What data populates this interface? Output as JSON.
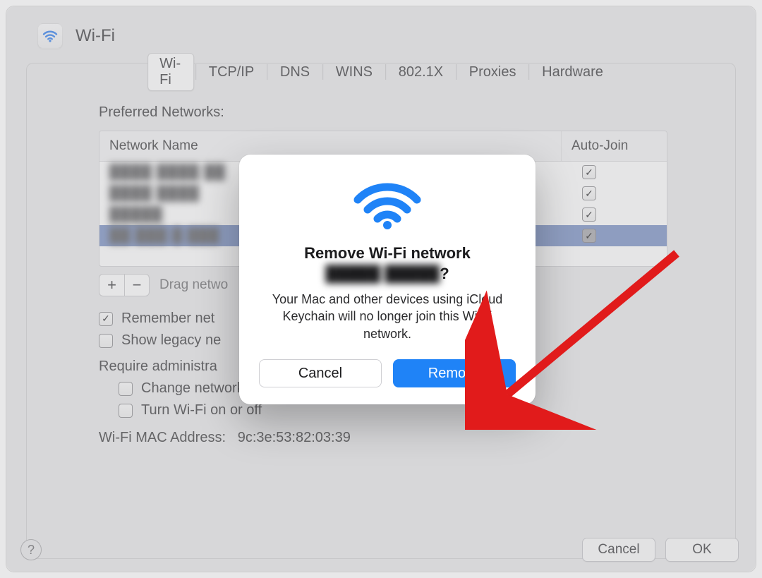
{
  "header": {
    "title": "Wi-Fi"
  },
  "tabs": {
    "items": [
      "Wi-Fi",
      "TCP/IP",
      "DNS",
      "WINS",
      "802.1X",
      "Proxies",
      "Hardware"
    ],
    "active_index": 0
  },
  "section": {
    "label": "Preferred Networks:"
  },
  "table": {
    "columns": {
      "name": "Network Name",
      "auto": "Auto-Join"
    },
    "rows": [
      {
        "name": "████ ████ ██",
        "auto_join": true,
        "selected": false
      },
      {
        "name": "████ ████",
        "auto_join": true,
        "selected": false
      },
      {
        "name": "█████",
        "auto_join": true,
        "selected": false
      },
      {
        "name": "██ ███ █ ███",
        "auto_join": true,
        "selected": true
      }
    ],
    "hint": "Drag netwo",
    "add_label": "+",
    "remove_label": "−"
  },
  "options": {
    "remember": {
      "label": "Remember net",
      "checked": true
    },
    "legacy": {
      "label": "Show legacy ne",
      "checked": false
    },
    "require": {
      "label": "Require administra"
    },
    "change": {
      "label": "Change networks",
      "checked": false
    },
    "toggle": {
      "label": "Turn Wi-Fi on or off",
      "checked": false
    }
  },
  "mac": {
    "label": "Wi-Fi MAC Address:",
    "value": "9c:3e:53:82:03:39"
  },
  "footer": {
    "cancel": "Cancel",
    "ok": "OK"
  },
  "help": {
    "label": "?"
  },
  "modal": {
    "title_prefix": "Remove Wi-Fi network ",
    "title_name": "█████ █████",
    "title_suffix": "?",
    "message": "Your Mac and other devices using iCloud Keychain will no longer join this Wi-Fi network.",
    "cancel": "Cancel",
    "confirm": "Remove"
  }
}
